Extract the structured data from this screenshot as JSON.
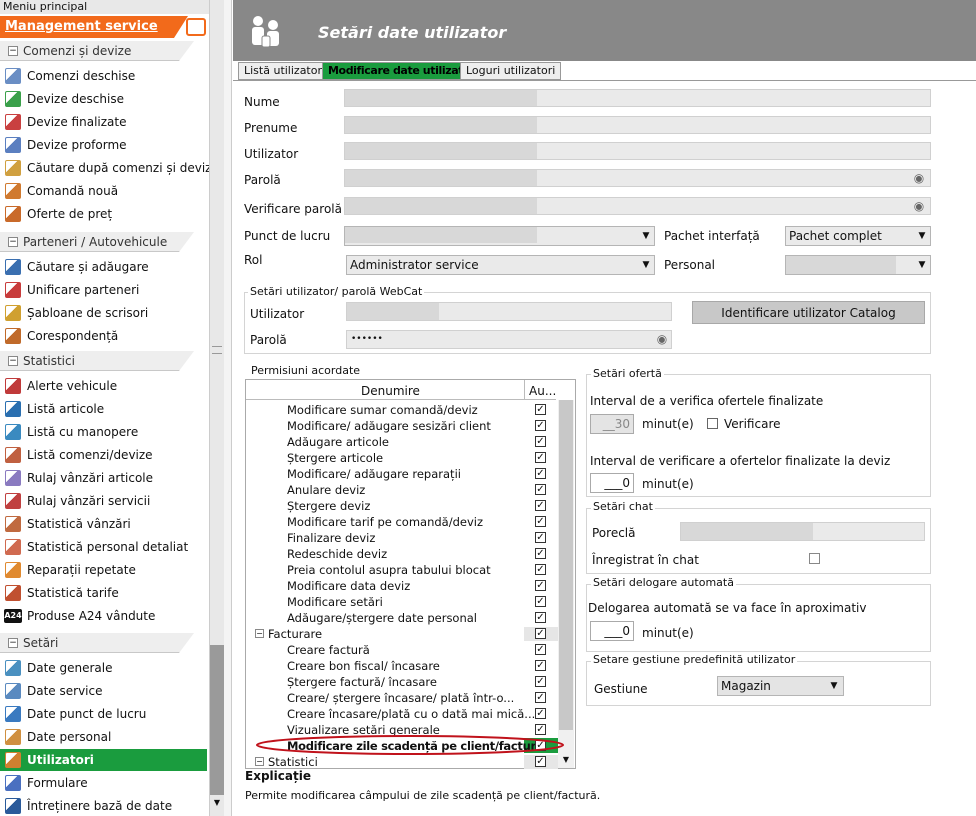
{
  "menu": {
    "title": "Meniu principal",
    "pin": " ↓",
    "app": "Management service",
    "sections": [
      {
        "label": "Comenzi și devize",
        "items": [
          "Comenzi deschise",
          "Devize deschise",
          "Devize finalizate",
          "Devize proforme",
          "Căutare după comenzi și devize",
          "Comandă nouă",
          "Oferte de preț"
        ]
      },
      {
        "label": "Parteneri / Autovehicule",
        "items": [
          "Căutare și adăugare",
          "Unificare parteneri",
          "Șabloane de scrisori",
          "Corespondență"
        ]
      },
      {
        "label": "Statistici",
        "items": [
          "Alerte vehicule",
          "Listă articole",
          "Listă cu manopere",
          "Listă comenzi/devize",
          "Rulaj vânzări articole",
          "Rulaj vânzări servicii",
          "Statistică vânzări",
          "Statistică personal detaliat",
          "Reparații repetate",
          "Statistică tarife",
          "Produse A24 vândute"
        ]
      },
      {
        "label": "Setări",
        "items": [
          "Date generale",
          "Date service",
          "Date punct de lucru",
          "Date personal",
          "Utilizatori",
          "Formulare",
          "Întreținere bază de date"
        ]
      }
    ],
    "a24": "A24"
  },
  "header": {
    "title": "Setări date utilizator"
  },
  "tabs": [
    "Listă utilizatori",
    "Modificare date utilizator",
    "Loguri utilizatori"
  ],
  "form": {
    "nume": "Nume",
    "prenume": "Prenume",
    "utilizator": "Utilizator",
    "parola": "Parolă",
    "verificare": "Verificare parolă",
    "punct": "Punct de lucru",
    "pachet": "Pachet interfață",
    "pachet_val": "Pachet complet",
    "rol": "Rol",
    "rol_val": "Administrator service",
    "personal": "Personal"
  },
  "webcat": {
    "title": "Setări utilizator/ parolă WebCat",
    "utilizator": "Utilizator",
    "parola": "Parolă",
    "parola_val": "••••••",
    "btn": "Identificare utilizator Catalog"
  },
  "perm": {
    "title": "Permisiuni acordate",
    "col1": "Denumire",
    "col2": "Au...",
    "rows": [
      {
        "t": "Modificare sumar comandă/deviz",
        "lvl": 2
      },
      {
        "t": "Modificare/ adăugare sesizări client",
        "lvl": 2
      },
      {
        "t": "Adăugare articole",
        "lvl": 2
      },
      {
        "t": "Ștergere articole",
        "lvl": 2
      },
      {
        "t": "Modificare/ adăugare reparații",
        "lvl": 2
      },
      {
        "t": "Anulare deviz",
        "lvl": 2
      },
      {
        "t": "Ștergere deviz",
        "lvl": 2
      },
      {
        "t": "Modificare tarif pe comandă/deviz",
        "lvl": 2
      },
      {
        "t": "Finalizare deviz",
        "lvl": 2
      },
      {
        "t": "Redeschide deviz",
        "lvl": 2
      },
      {
        "t": "Preia contolul asupra tabului blocat",
        "lvl": 2
      },
      {
        "t": "Modificare data deviz",
        "lvl": 2
      },
      {
        "t": "Modificare setări",
        "lvl": 2
      },
      {
        "t": "Adăugare/ștergere date personal",
        "lvl": 2
      },
      {
        "t": "Facturare",
        "lvl": 1
      },
      {
        "t": "Creare factură",
        "lvl": 2
      },
      {
        "t": "Creare bon fiscal/ încasare",
        "lvl": 2
      },
      {
        "t": "Ștergere factură/ încasare",
        "lvl": 2
      },
      {
        "t": "Creare/ ștergere încasare/ plată într-o...",
        "lvl": 2
      },
      {
        "t": "Creare încasare/plată cu o dată mai mică...",
        "lvl": 2
      },
      {
        "t": "Vizualizare setări generale",
        "lvl": 2
      },
      {
        "t": "Modificare zile scadență pe client/factură",
        "lvl": 2
      },
      {
        "t": "Statistici",
        "lvl": 1
      }
    ],
    "explain_title": "Explicație",
    "explain": "Permite modificarea câmpului de zile scadență pe client/factură."
  },
  "oferta": {
    "title": "Setări ofertă",
    "l1": "Interval de a verifica ofertele finalizate",
    "v1": "__30",
    "u1": "minut(e)",
    "chk": "Verificare",
    "l2": "Interval de verificare a ofertelor finalizate la deviz",
    "v2": "___0",
    "u2": "minut(e)"
  },
  "chat": {
    "title": "Setări chat",
    "porecla": "Poreclă",
    "inreg": "Înregistrat în chat"
  },
  "delegare": {
    "title": "Setări delogare automată",
    "l": "Delogarea automată se va face în aproximativ",
    "v": "___0",
    "u": "minut(e)"
  },
  "gestiune": {
    "title": "Setare gestiune predefinită utilizator",
    "l": "Gestiune",
    "v": "Magazin"
  },
  "colors": {
    "accent": "#f26a1b",
    "selected": "#1a9c3e",
    "header": "#888888"
  }
}
